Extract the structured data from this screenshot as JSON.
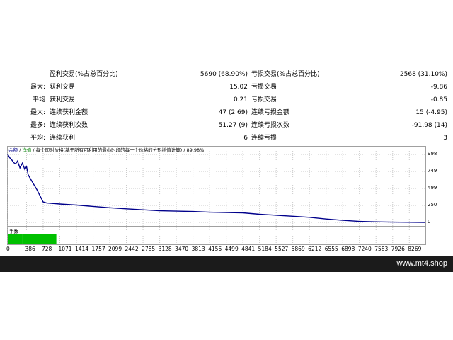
{
  "stats": {
    "rows": [
      {
        "label": "",
        "name1": "盈利交易(%占总百分比)",
        "value1": "5690 (68.90%)",
        "name2": "亏损交易(%占总百分比)",
        "value2": "2568 (31.10%)"
      },
      {
        "label": "最大:",
        "name1": "获利交易",
        "value1": "15.02",
        "name2": "亏损交易",
        "value2": "-9.86"
      },
      {
        "label": "平均",
        "name1": "获利交易",
        "value1": "0.21",
        "name2": "亏损交易",
        "value2": "-0.85"
      },
      {
        "label": "最大:",
        "name1": "连续获利金额",
        "value1": "47 (2.69)",
        "name2": "连续亏损金额",
        "value2": "15 (-4.95)"
      },
      {
        "label": "最多:",
        "name1": "连续获利次数",
        "value1": "51.27 (9)",
        "name2": "连续亏损次数",
        "value2": "-91.98 (14)"
      },
      {
        "label": "平均:",
        "name1": "连续获利",
        "value1": "6",
        "name2": "连续亏损",
        "value2": "3"
      }
    ]
  },
  "chart": {
    "title_part1": "余额",
    "title_sep1": " / ",
    "title_part2": "净值",
    "title_rest": " / 每个即时价格(基于所有可利用的最小时段的每一个价格的分形插值计算) / 89.98%",
    "sub_title": "手数",
    "colors": {
      "balance": "#00008b",
      "equity": "#008000",
      "lots": "#00c000",
      "grid": "#c8c8c8"
    }
  },
  "chart_data": {
    "type": "line",
    "series": [
      {
        "name": "余额",
        "x": [
          0,
          40,
          80,
          120,
          160,
          200,
          250,
          300,
          350,
          386,
          420,
          500,
          600,
          728,
          800,
          1071,
          1414,
          1757,
          2099,
          2442,
          2785,
          3128,
          3470,
          3813,
          4156,
          4499,
          4841,
          5184,
          5527,
          5869,
          6212,
          6555,
          6898,
          7240,
          7583,
          7926,
          8269,
          8600
        ],
        "y": [
          998,
          950,
          920,
          880,
          860,
          900,
          800,
          870,
          780,
          820,
          700,
          600,
          480,
          300,
          285,
          270,
          255,
          235,
          215,
          200,
          185,
          170,
          165,
          160,
          150,
          145,
          140,
          120,
          105,
          90,
          75,
          50,
          30,
          15,
          8,
          4,
          2,
          0
        ]
      }
    ],
    "lots": {
      "x": [
        0,
        300,
        1000
      ],
      "y": [
        2,
        2,
        1
      ]
    },
    "xticks": [
      0,
      386,
      728,
      1071,
      1414,
      1757,
      2099,
      2442,
      2785,
      3128,
      3470,
      3813,
      4156,
      4499,
      4841,
      5184,
      5527,
      5869,
      6212,
      6555,
      6898,
      7240,
      7583,
      7926,
      8269
    ],
    "yticks": [
      998,
      749,
      499,
      250,
      0
    ],
    "xlim": [
      0,
      8600
    ],
    "ylim": [
      0,
      998
    ],
    "grid": true
  },
  "footer": {
    "text": "www.mt4.shop"
  }
}
